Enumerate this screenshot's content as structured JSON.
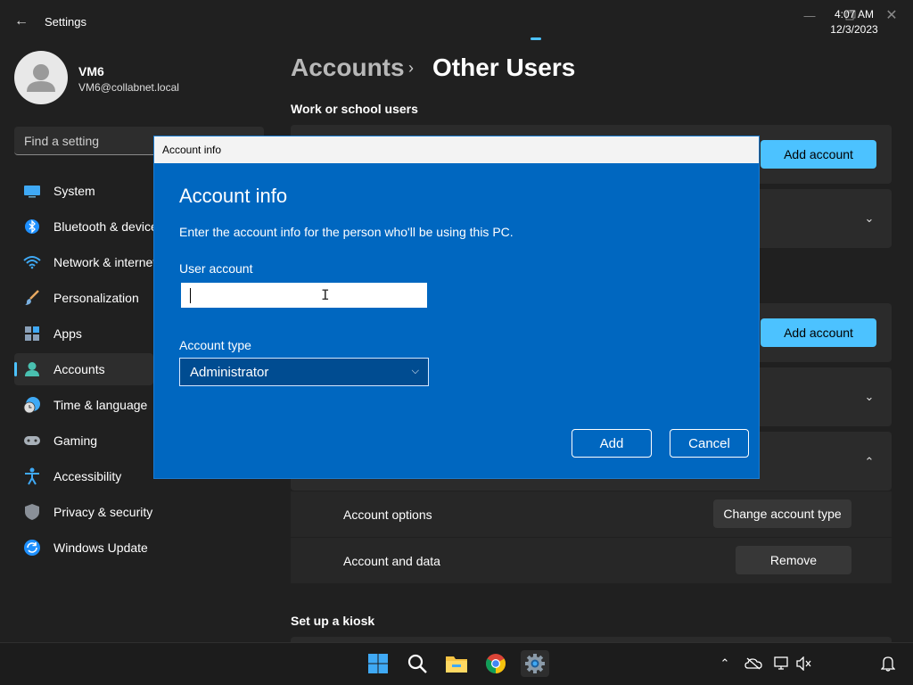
{
  "window": {
    "title": "Settings",
    "back_icon": "arrow-left-icon",
    "controls": [
      "minimize-icon",
      "restore-icon",
      "close-icon"
    ]
  },
  "user": {
    "name": "VM6",
    "email": "VM6@collabnet.local"
  },
  "search": {
    "placeholder": "Find a setting"
  },
  "nav": {
    "items": [
      {
        "label": "System",
        "icon": "monitor-icon"
      },
      {
        "label": "Bluetooth & devices",
        "icon": "bluetooth-icon"
      },
      {
        "label": "Network & internet",
        "icon": "wifi-icon"
      },
      {
        "label": "Personalization",
        "icon": "brush-icon"
      },
      {
        "label": "Apps",
        "icon": "apps-icon"
      },
      {
        "label": "Accounts",
        "icon": "person-icon",
        "active": true
      },
      {
        "label": "Time & language",
        "icon": "clock-globe-icon"
      },
      {
        "label": "Gaming",
        "icon": "gamepad-icon"
      },
      {
        "label": "Accessibility",
        "icon": "accessibility-icon"
      },
      {
        "label": "Privacy & security",
        "icon": "shield-icon"
      },
      {
        "label": "Windows Update",
        "icon": "update-icon"
      }
    ]
  },
  "main": {
    "breadcrumb_root": "Accounts",
    "breadcrumb_sep": "›",
    "breadcrumb_current": "Other Users",
    "work_school_title": "Work or school users",
    "add_account_1": "Add account",
    "add_account_2": "Add account",
    "account_options_label": "Account options",
    "change_account_type": "Change account type",
    "account_data_label": "Account and data",
    "remove": "Remove",
    "kiosk_title": "Set up a kiosk"
  },
  "dialog": {
    "window_title": "Account info",
    "heading": "Account info",
    "description": "Enter the account info for the person who'll be using this PC.",
    "user_account_label": "User account",
    "user_account_value": "",
    "account_type_label": "Account type",
    "account_type_value": "Administrator",
    "add_button": "Add",
    "cancel_button": "Cancel"
  },
  "taskbar": {
    "time": "4:07 AM",
    "date": "12/3/2023",
    "apps": [
      "start-icon",
      "search-icon",
      "file-explorer-icon",
      "chrome-icon",
      "settings-gear-icon"
    ],
    "tray": [
      "chevron-up-icon",
      "onedrive-icon",
      "network-icon",
      "volume-muted-icon",
      "notification-bell-icon"
    ]
  },
  "colors": {
    "accent": "#4cc2ff",
    "dialog_blue": "#0067c0",
    "background": "#202020"
  }
}
